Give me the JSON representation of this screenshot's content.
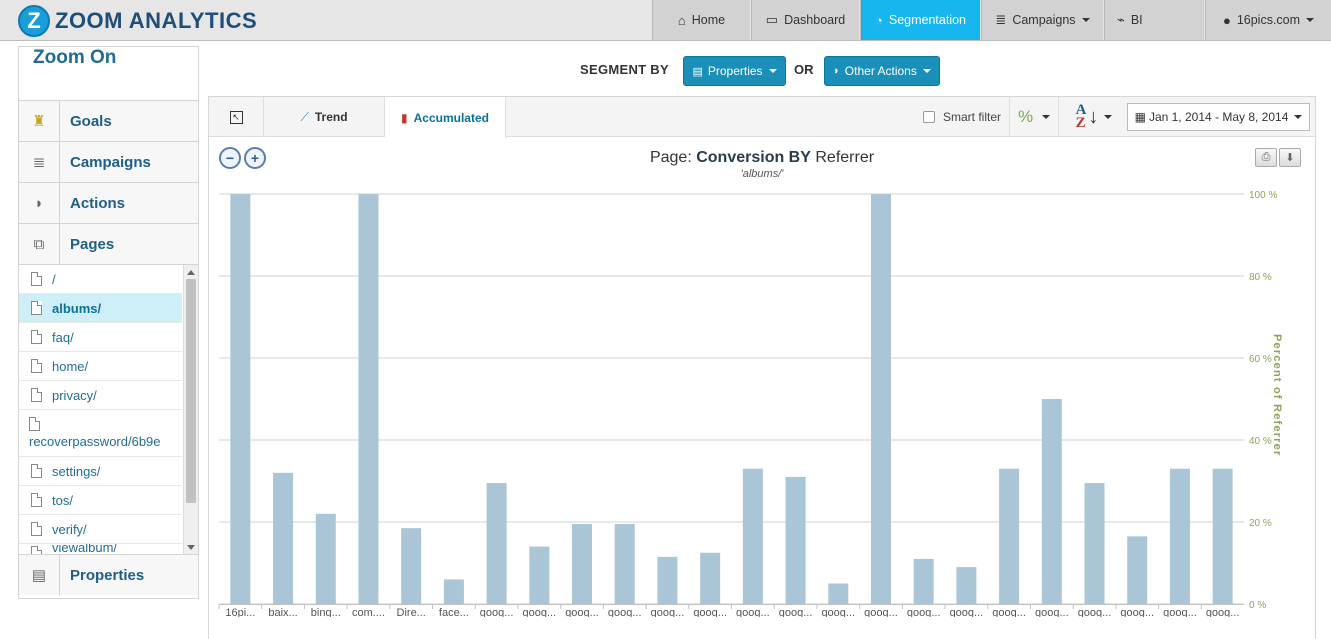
{
  "app": {
    "logo_letter": "Z",
    "logo_text": "ZOOM ANALYTICS"
  },
  "nav": {
    "home": "Home",
    "dashboard": "Dashboard",
    "segmentation": "Segmentation",
    "campaigns": "Campaigns",
    "bi": "BI",
    "account": "16pics.com"
  },
  "sidebar": {
    "title": "Zoom On",
    "goals": "Goals",
    "campaigns": "Campaigns",
    "actions": "Actions",
    "pages": "Pages",
    "properties": "Properties",
    "page_items": [
      "/",
      "albums/",
      "faq/",
      "home/",
      "privacy/",
      "recoverpassword/6b9e",
      "settings/",
      "tos/",
      "verify/",
      "viewalbum/"
    ],
    "selected_page": "albums/"
  },
  "segment": {
    "label": "SEGMENT BY",
    "or": "OR",
    "properties_btn": "Properties",
    "other_actions_btn": "Other Actions"
  },
  "toolbar": {
    "trend": "Trend",
    "accumulated": "Accumulated",
    "smart_filter": "Smart filter",
    "percent_symbol": "%",
    "date_range": "Jan 1, 2014 - May 8, 2014"
  },
  "chart_data": {
    "type": "bar",
    "title_prefix": "Page:",
    "title_main": "Conversion BY",
    "title_suffix": "Referrer",
    "subtitle": "'albums/'",
    "ylabel": "Percent of Referrer",
    "ylim": [
      0,
      100
    ],
    "y_ticks": [
      "0 %",
      "20 %",
      "40 %",
      "60 %",
      "80 %",
      "100 %"
    ],
    "bar_color": "#a9c5d6",
    "tick_color": "#8ea356",
    "categories": [
      "16pi...",
      "baix...",
      "bing...",
      "com....",
      "Dire...",
      "face...",
      "goog...",
      "goog...",
      "goog...",
      "goog...",
      "goog...",
      "goog...",
      "goog...",
      "goog...",
      "goog...",
      "goog...",
      "goog...",
      "goog...",
      "goog...",
      "goog...",
      "goog...",
      "goog...",
      "goog...",
      "goog..."
    ],
    "values": [
      100,
      32,
      22,
      100,
      18.5,
      6,
      29.5,
      14,
      19.5,
      19.5,
      11.5,
      12.5,
      33,
      31,
      5,
      100,
      11,
      9,
      33,
      50,
      29.5,
      16.5,
      33,
      33
    ]
  }
}
